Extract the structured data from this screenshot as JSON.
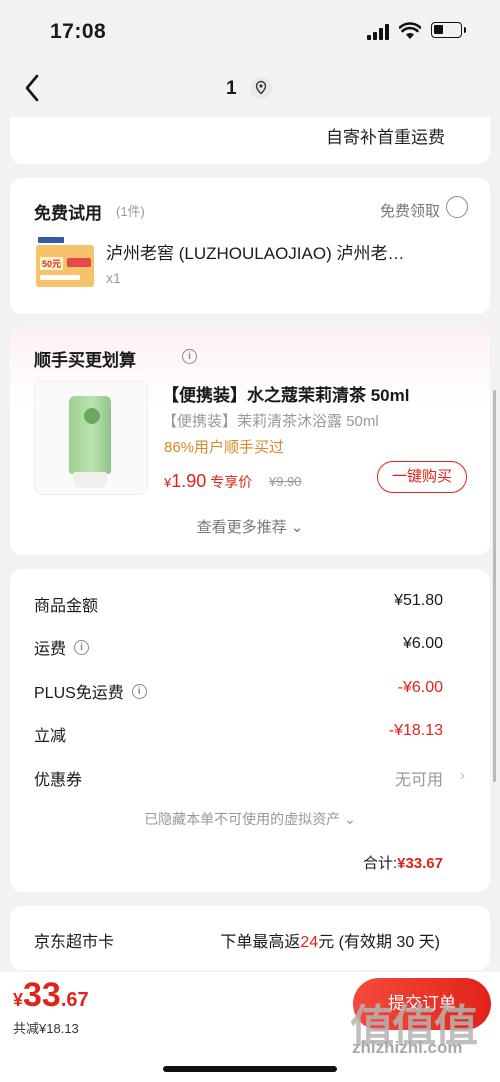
{
  "status_bar": {
    "time": "17:08"
  },
  "nav": {
    "count": "1"
  },
  "shipping": {
    "text": "自寄补首重运费"
  },
  "free_trial": {
    "title": "免费试用",
    "count": "(1件)",
    "claim": "免费领取",
    "product_name": "泸州老窖 (LUZHOULAOJIAO) 泸州老…",
    "quantity": "x1",
    "thumb_badge": "50元"
  },
  "recommend": {
    "title": "顺手买更划算",
    "product_name": "【便携装】水之蔻茉莉清茶 50ml",
    "product_sub": "【便携装】茉莉清茶沐浴露 50ml",
    "sold": "86%用户顺手买过",
    "price_symbol": "¥",
    "price": "1.90",
    "price_tag": "专享价",
    "original_price": "¥9.90",
    "buy_label": "一键购买",
    "more_label": "查看更多推荐 ⌄"
  },
  "summary": {
    "rows": [
      {
        "label": "商品金额",
        "value": "¥51.80"
      },
      {
        "label": "运费",
        "value": "¥6.00"
      },
      {
        "label": "PLUS免运费",
        "value": "-¥6.00"
      },
      {
        "label": "立减",
        "value": "-¥18.13"
      },
      {
        "label": "优惠券",
        "value": "无可用"
      }
    ],
    "hidden_note": "已隐藏本单不可使用的虚拟资产 ⌄",
    "total_label": "合计:",
    "total_value": "¥33.67"
  },
  "jd_card": {
    "title": "京东超市卡",
    "text_prefix": "下单最高返",
    "amount": "24",
    "text_suffix": "元 (有效期 30 天)"
  },
  "bottom": {
    "currency": "¥",
    "total_int": "33",
    "total_dec": ".67",
    "save_label": "共减",
    "save_value": "¥18.13",
    "submit_label": "提交订单"
  },
  "watermark": {
    "text": "值值值",
    "url": "zhizhizhi.com"
  },
  "colors": {
    "accent": "#e2231a",
    "orange": "#d6892b",
    "background": "#f2f2f2"
  }
}
